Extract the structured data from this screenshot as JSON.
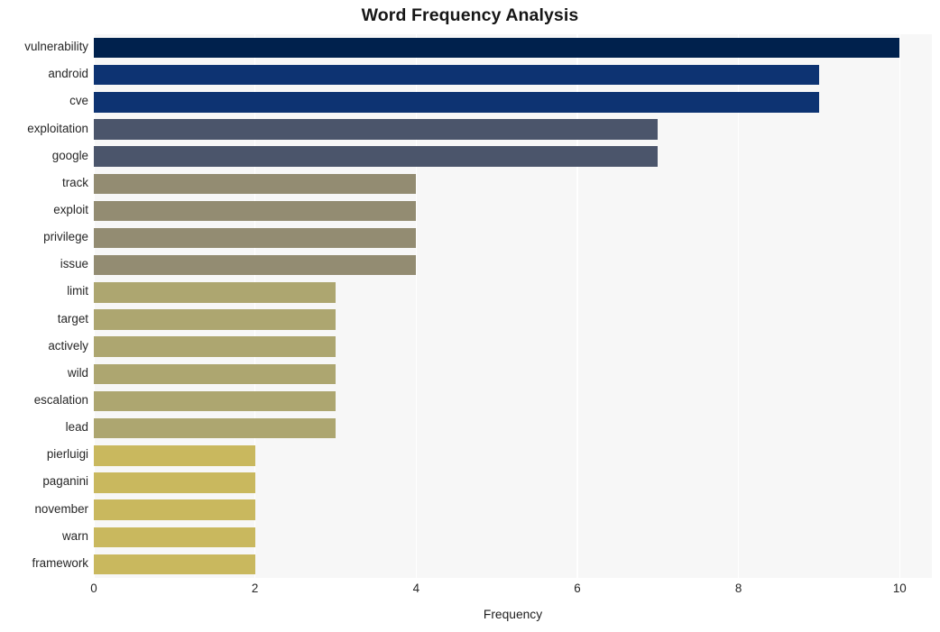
{
  "chart_data": {
    "type": "bar",
    "orientation": "horizontal",
    "title": "Word Frequency Analysis",
    "xlabel": "Frequency",
    "ylabel": "",
    "xlim": [
      0,
      10.4
    ],
    "xticks": [
      0,
      2,
      4,
      6,
      8,
      10
    ],
    "xtick_labels": [
      "0",
      "2",
      "4",
      "6",
      "8",
      "10"
    ],
    "grid": "vertical-white-on-light-gray",
    "legend": "none",
    "categories": [
      "vulnerability",
      "android",
      "cve",
      "exploitation",
      "google",
      "track",
      "exploit",
      "privilege",
      "issue",
      "limit",
      "target",
      "actively",
      "wild",
      "escalation",
      "lead",
      "pierluigi",
      "paganini",
      "november",
      "warn",
      "framework"
    ],
    "values": [
      10,
      9,
      9,
      7,
      7,
      4,
      4,
      4,
      4,
      3,
      3,
      3,
      3,
      3,
      3,
      2,
      2,
      2,
      2,
      2
    ],
    "bar_colors": [
      "#00214d",
      "#0d3372",
      "#0d3372",
      "#4b556b",
      "#4b556b",
      "#938c72",
      "#938c72",
      "#938c72",
      "#938c72",
      "#ada670",
      "#ada670",
      "#ada670",
      "#ada670",
      "#ada670",
      "#ada670",
      "#c9b85e",
      "#c9b85e",
      "#c9b85e",
      "#c9b85e",
      "#c9b85e"
    ]
  },
  "style": {
    "figure_background": "#ffffff",
    "plot_background": "#f7f7f7",
    "gridline_color": "#ffffff",
    "title_color": "#161616",
    "tick_label_color": "#262626"
  }
}
